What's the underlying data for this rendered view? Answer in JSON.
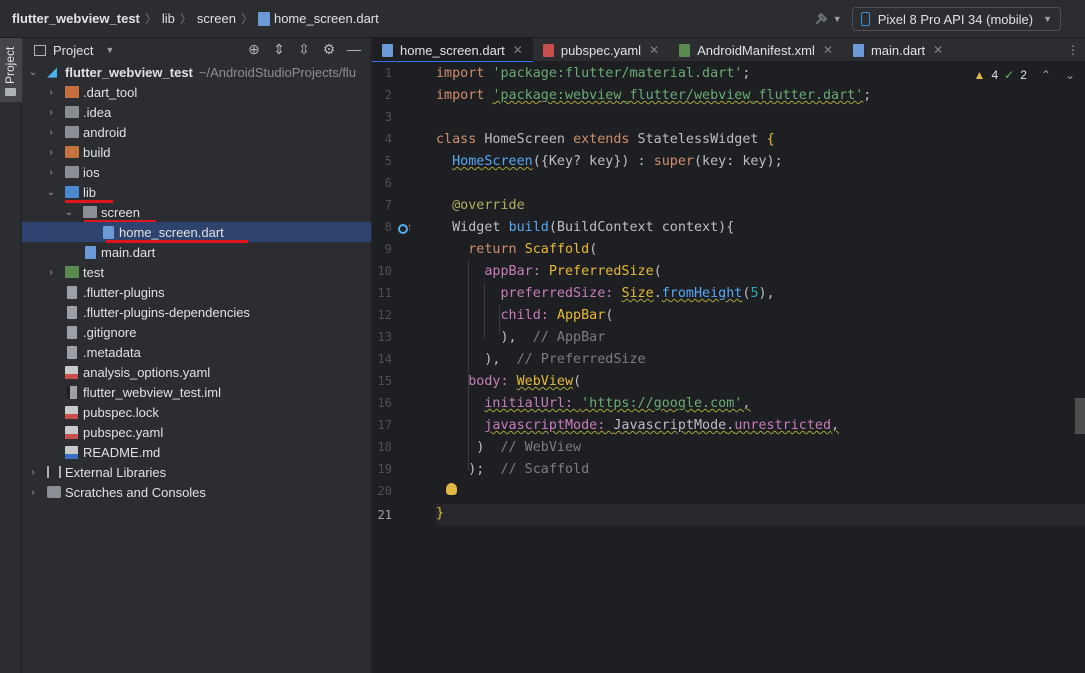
{
  "breadcrumb": {
    "project": "flutter_webview_test",
    "folder1": "lib",
    "folder2": "screen",
    "file": "home_screen.dart"
  },
  "toolbar": {
    "device": "Pixel 8 Pro API 34 (mobile)"
  },
  "toolstrip": {
    "project_tab": "Project"
  },
  "project_panel": {
    "title": "Project",
    "root_name": "flutter_webview_test",
    "root_path": "~/AndroidStudioProjects/flu",
    "items": [
      {
        "label": ".dart_tool"
      },
      {
        "label": ".idea"
      },
      {
        "label": "android"
      },
      {
        "label": "build"
      },
      {
        "label": "ios"
      },
      {
        "label": "lib"
      },
      {
        "label": "screen"
      },
      {
        "label": "home_screen.dart"
      },
      {
        "label": "main.dart"
      },
      {
        "label": "test"
      },
      {
        "label": ".flutter-plugins"
      },
      {
        "label": ".flutter-plugins-dependencies"
      },
      {
        "label": ".gitignore"
      },
      {
        "label": ".metadata"
      },
      {
        "label": "analysis_options.yaml"
      },
      {
        "label": "flutter_webview_test.iml"
      },
      {
        "label": "pubspec.lock"
      },
      {
        "label": "pubspec.yaml"
      },
      {
        "label": "README.md"
      },
      {
        "label": "External Libraries"
      },
      {
        "label": "Scratches and Consoles"
      }
    ]
  },
  "tabs": [
    {
      "label": "home_screen.dart"
    },
    {
      "label": "pubspec.yaml"
    },
    {
      "label": "AndroidManifest.xml"
    },
    {
      "label": "main.dart"
    }
  ],
  "inspections": {
    "warnings": "4",
    "weak_warnings": "2"
  },
  "line_numbers": [
    "1",
    "2",
    "3",
    "4",
    "5",
    "6",
    "7",
    "8",
    "9",
    "10",
    "11",
    "12",
    "13",
    "14",
    "15",
    "16",
    "17",
    "18",
    "19",
    "20",
    "21"
  ],
  "code": {
    "l1_kw": "import",
    "l1_str": "'package:flutter/material.dart'",
    "l1_end": ";",
    "l2_kw": "import",
    "l2_str": "'package:webview_flutter/webview_flutter.dart'",
    "l2_end": ";",
    "l4_kw1": "class",
    "l4_name": " HomeScreen ",
    "l4_kw2": "extends",
    "l4_sup": " StatelessWidget ",
    "l4_brace": "{",
    "l5_fn": "HomeScreen",
    "l5_rest": "({Key? key}) : ",
    "l5_super": "super",
    "l5_end": "(key: key);",
    "l7_ann": "@override",
    "l8_type": "Widget ",
    "l8_fn": "build",
    "l8_rest": "(BuildContext context){",
    "l9_kw": "return ",
    "l9_cls": "Scaffold",
    "l9_end": "(",
    "l10_prop": "appBar: ",
    "l10_cls": "PreferredSize",
    "l10_end": "(",
    "l11_prop": "preferredSize: ",
    "l11_cls": "Size",
    "l11_dot": ".",
    "l11_fn": "fromHeight",
    "l11_p1": "(",
    "l11_num": "5",
    "l11_p2": "),",
    "l12_prop": "child: ",
    "l12_cls": "AppBar",
    "l12_end": "(",
    "l13_code": "),  ",
    "l13_cmt": "// AppBar",
    "l14_code": "),  ",
    "l14_cmt": "// PreferredSize",
    "l15_prop": "body: ",
    "l15_cls": "WebView",
    "l15_end": "(",
    "l16_prop": "initialUrl: ",
    "l16_str": "'https://google.com'",
    "l16_end": ",",
    "l17_prop": "javascriptMode: ",
    "l17_cls": "JavascriptMode",
    "l17_dot": ".",
    "l17_val": "unrestricted",
    "l17_end": ",",
    "l18_code": ")  ",
    "l18_cmt": "// WebView",
    "l19_code": ");  ",
    "l19_cmt": "// Scaffold",
    "l21_code": "}"
  },
  "colors": {
    "keyword": "#cf8e6d",
    "string": "#6aab73",
    "function": "#56a8f5",
    "class": "#e8ba36",
    "comment": "#7a7e85",
    "selection": "#2e436e",
    "annotation_underline": "#e0141b"
  },
  "icons": [
    "flutter-icon",
    "folder-icon",
    "dart-file-icon",
    "yaml-file-icon",
    "gear-icon",
    "minus-icon",
    "hammer-icon",
    "phone-icon",
    "run-icon"
  ]
}
